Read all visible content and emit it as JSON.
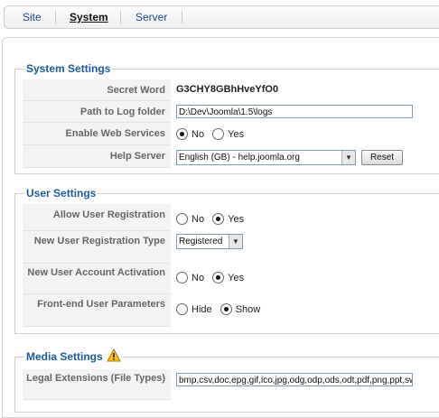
{
  "tabs": [
    {
      "label": "Site",
      "active": false
    },
    {
      "label": "System",
      "active": true
    },
    {
      "label": "Server",
      "active": false
    }
  ],
  "system_settings": {
    "legend": "System Settings",
    "secret_word": {
      "label": "Secret Word",
      "value": "G3CHY8GBhHveYfO0"
    },
    "log_folder": {
      "label": "Path to Log folder",
      "value": "D:\\Dev\\Joomla\\1.5\\logs"
    },
    "web_services": {
      "label": "Enable Web Services",
      "options": [
        "No",
        "Yes"
      ],
      "selected": "No"
    },
    "help_server": {
      "label": "Help Server",
      "value": "English (GB) - help.joomla.org",
      "reset_label": "Reset"
    }
  },
  "user_settings": {
    "legend": "User Settings",
    "allow_registration": {
      "label": "Allow User Registration",
      "options": [
        "No",
        "Yes"
      ],
      "selected": "Yes"
    },
    "new_user_type": {
      "label": "New User Registration Type",
      "value": "Registered"
    },
    "activation": {
      "label": "New User Account Activation",
      "options": [
        "No",
        "Yes"
      ],
      "selected": "Yes"
    },
    "frontend_params": {
      "label": "Front-end User Parameters",
      "options": [
        "Hide",
        "Show"
      ],
      "selected": "Show"
    }
  },
  "media_settings": {
    "legend": "Media Settings",
    "warning_icon": "warning-triangle-icon",
    "legal_extensions": {
      "label": "Legal Extensions (File Types)",
      "value": "bmp,csv,doc,epg,gif,ico,jpg,odg,odp,ods,odt,pdf,png,ppt,swf,txt,xcf,xls,BMP,CSV,DOC,EPG,GIF"
    }
  }
}
